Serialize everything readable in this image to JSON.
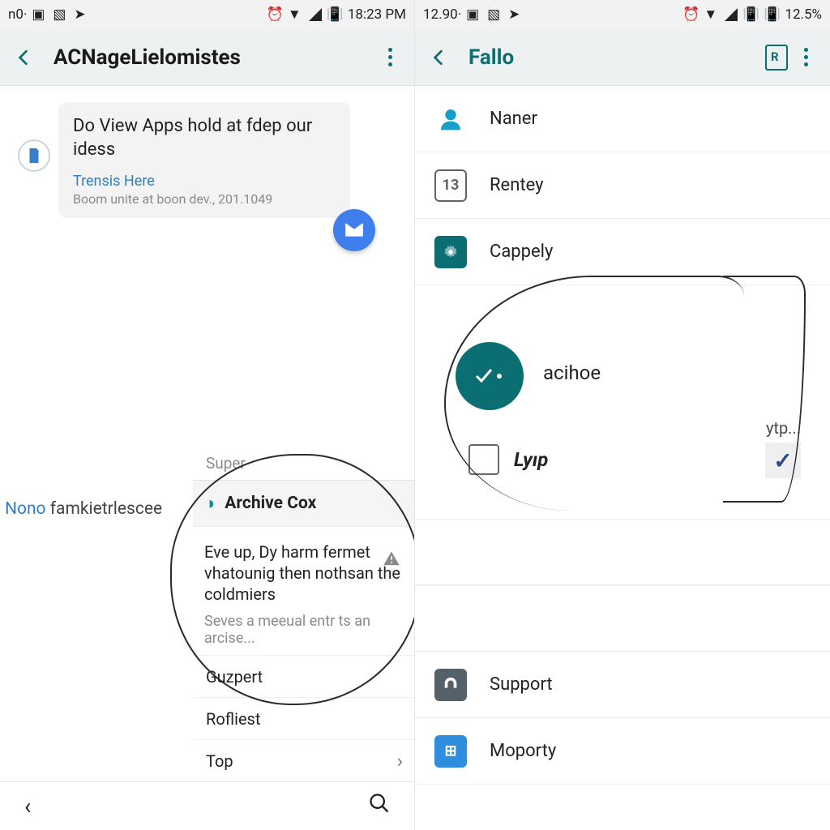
{
  "left": {
    "statusbar": {
      "left_text": "n0·",
      "time": "18:23 PM"
    },
    "appbar": {
      "title": "ACNageLielomistes"
    },
    "message": {
      "text": "Do View Apps hold at fdep our idess",
      "sub_title": "Trensis Here",
      "sub_meta": "Boom unite at boon dev., 201.1049"
    },
    "super_label": "Super",
    "nono_prefix": "Nono ",
    "nono_rest": "famkietrlescee",
    "panel": {
      "header": "Archive Cox",
      "body_line1": "Eve up, Dy harm fermet vhatounig then nothsan the coldmiers",
      "body_line2": "Seves a meeual entr ts an arcise...",
      "items": [
        "Guzpert",
        "Rofliest",
        "Top"
      ]
    }
  },
  "right": {
    "statusbar": {
      "left_text": "12.90·",
      "battery": "12.5%"
    },
    "appbar": {
      "title": "Fallo"
    },
    "list": [
      {
        "label": "Naner",
        "icon": "person"
      },
      {
        "label": "Rentey",
        "icon": "calendar",
        "badge": "13"
      },
      {
        "label": "Cappely",
        "icon": "gear"
      }
    ],
    "acihoe": "acihoe",
    "lyip": "Lyıp",
    "ytp": "ytp...",
    "list2": [
      {
        "label": "Support",
        "icon": "support"
      },
      {
        "label": "Moporty",
        "icon": "moporty"
      }
    ]
  }
}
